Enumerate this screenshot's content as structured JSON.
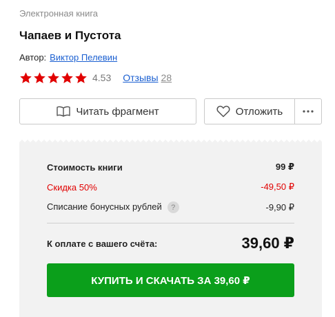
{
  "book": {
    "category": "Электронная книга",
    "title": "Чапаев и Пустота",
    "author_label": "Автор:",
    "author_name": "Виктор Пелевин",
    "rating": {
      "stars": 5,
      "value": "4.53",
      "reviews_label": "Отзывы",
      "reviews_count": "28"
    }
  },
  "actions": {
    "read_fragment": "Читать фрагмент",
    "postpone": "Отложить",
    "more_icon": "more-dots-icon"
  },
  "pricing": {
    "cost_label": "Стоимость книги",
    "cost_value": "99 ₽",
    "discount_label": "Скидка 50%",
    "discount_value": "-49,50 ₽",
    "bonus_label": "Списание бонусных рублей",
    "bonus_help": "?",
    "bonus_value": "-9,90 ₽",
    "total_label": "К оплате с вашего счёта:",
    "total_value": "39,60 ₽",
    "buy_button": "КУПИТЬ И СКАЧАТЬ ЗА 39,60 ₽"
  },
  "colors": {
    "link": "#1a5fd1",
    "star": "#e10000",
    "discount": "#e10000",
    "buy_button": "#0b9f1b",
    "price_box": "#f2f2f2"
  }
}
